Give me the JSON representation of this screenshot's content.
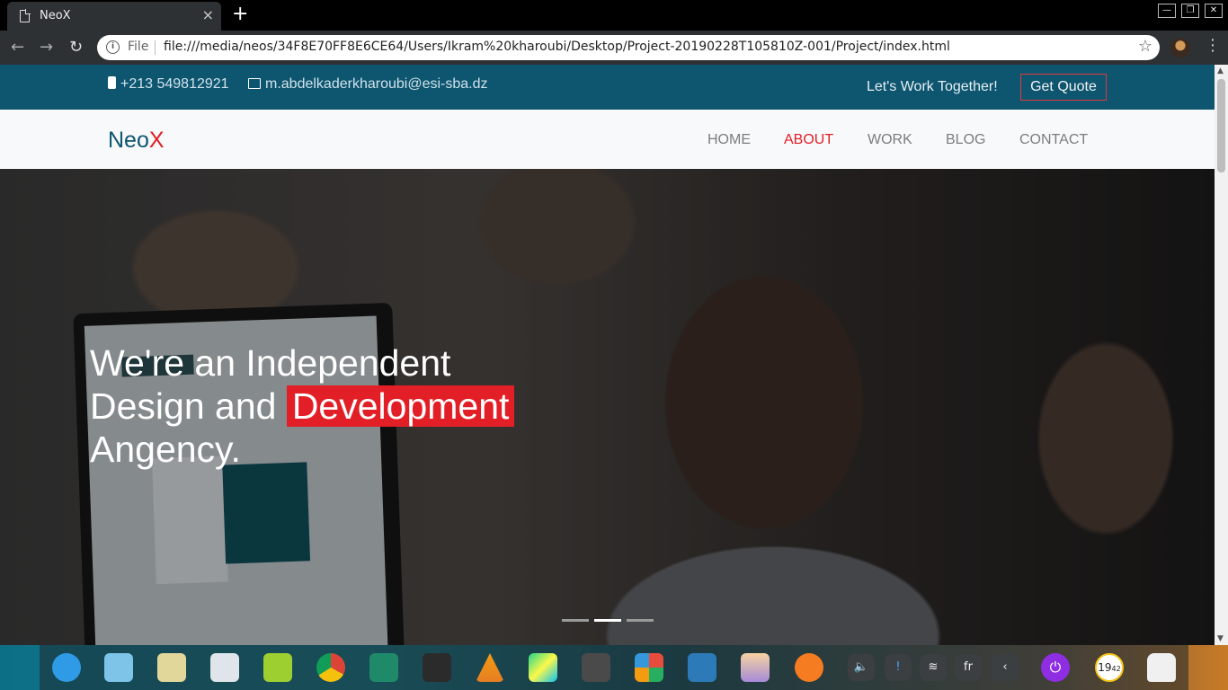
{
  "browser": {
    "tab_title": "NeoX",
    "tab_close": "×",
    "new_tab": "+",
    "scheme_label": "File",
    "url": "file:///media/neos/34F8E70FF8E6CE64/Users/Ikram%20kharoubi/Desktop/Project-20190228T105810Z-001/Project/index.html",
    "window_controls": [
      "minimize-icon",
      "restore-icon",
      "close-icon"
    ]
  },
  "topbar": {
    "phone": "+213 549812921",
    "email": "m.abdelkaderkharoubi@esi-sba.dz",
    "tagline": "Let's Work Together!",
    "quote_button": "Get Quote",
    "background": "#0e5570",
    "accent": "#e21f26"
  },
  "header": {
    "logo_main": "Neo",
    "logo_accent": "X",
    "menu": [
      {
        "label": "HOME",
        "active": false
      },
      {
        "label": "ABOUT",
        "active": true
      },
      {
        "label": "WORK",
        "active": false
      },
      {
        "label": "BLOG",
        "active": false
      },
      {
        "label": "CONTACT",
        "active": false
      }
    ]
  },
  "hero": {
    "line1": "We're an Independent",
    "line2_prefix": "Design and ",
    "line2_highlight": "Development",
    "line3": "Angency.",
    "slides": 3,
    "active_slide": 2
  },
  "dock": {
    "apps": [
      "launcher-icon",
      "multitasking-icon",
      "file-manager-icon",
      "app-store-icon",
      "music-icon",
      "chrome-icon",
      "tweak-icon",
      "terminal-icon",
      "vlc-icon",
      "pycharm-icon",
      "sublime-text-icon",
      "office-icon",
      "vscode-icon",
      "image-viewer-icon",
      "vlc-alt-icon"
    ],
    "tray": {
      "volume": "volume-icon",
      "notification": "!",
      "wifi": "wifi-icon",
      "keyboard_layout": "fr",
      "expand": "‹",
      "clock_hour": "19",
      "clock_minute": "42"
    }
  }
}
